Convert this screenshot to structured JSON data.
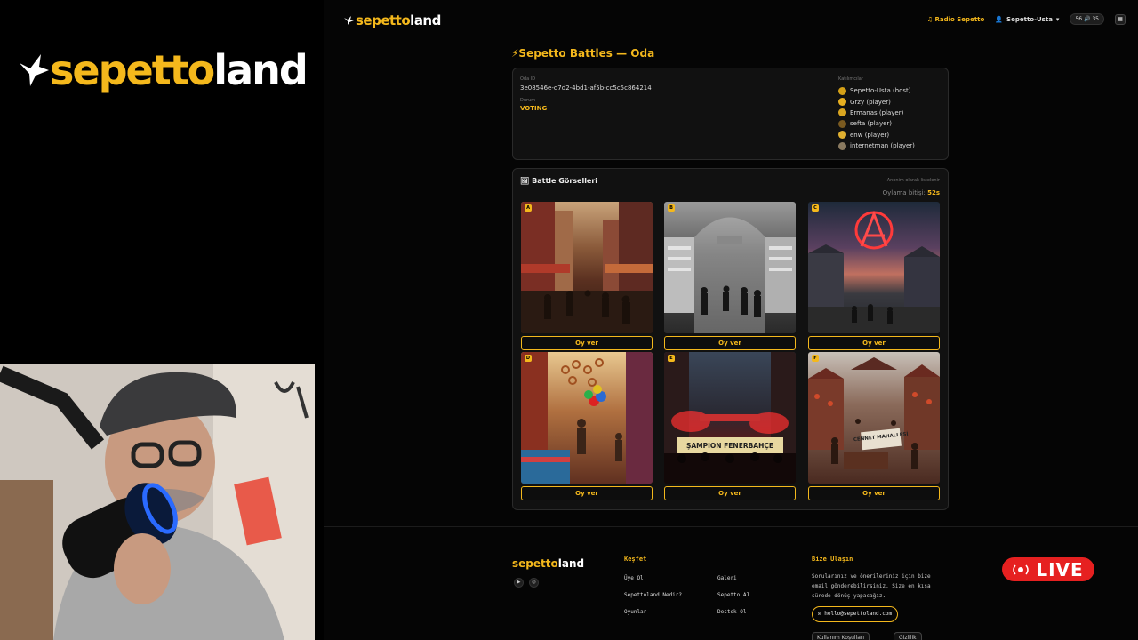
{
  "brand": {
    "part1": "sepetto",
    "part2": "land"
  },
  "nav": {
    "radio": "Radio Sepetto",
    "user": "Sepetto-Usta",
    "counter": "56 🔊 35"
  },
  "page": {
    "heading": "⚡Sepetto Battles — Oda"
  },
  "room": {
    "id_label": "Oda ID",
    "id_value": "3e08546e-d7d2-4bd1-af5b-cc5c5c864214",
    "status_label": "Durum",
    "status_value": "VOTING",
    "participants_label": "Katılımcılar",
    "participants": [
      {
        "name": "Sepetto-Usta (host)",
        "color": "#d4a017"
      },
      {
        "name": "Grzy (player)",
        "color": "#e8b020"
      },
      {
        "name": "Ermanas (player)",
        "color": "#d9a520"
      },
      {
        "name": "sefta (player)",
        "color": "#7a5a20"
      },
      {
        "name": "enw (player)",
        "color": "#e0b030"
      },
      {
        "name": "internetman (player)",
        "color": "#8a7a60"
      }
    ]
  },
  "battle": {
    "title": "Battle Görselleri",
    "anon_note": "Anonim olarak listelenir",
    "timer_label": "Oylama bitişi:",
    "timer_value": "52s",
    "vote_label": "Oy ver",
    "entries": [
      "A",
      "B",
      "C",
      "D",
      "E",
      "F"
    ],
    "banner_e": "ŞAMPİON FENERBAHÇE",
    "banner_f": "CENNET MAHALLESİ"
  },
  "footer": {
    "explore_heading": "Keşfet",
    "links": [
      "Üye Ol",
      "Galeri",
      "Sepettoland Nedir?",
      "Sepetto AI",
      "Oyunlar",
      "Destek Ol"
    ],
    "contact_heading": "Bize Ulaşın",
    "contact_text": "Sorularınız ve önerileriniz için bize email gönderebilirsiniz. Size en kısa sürede dönüş yapacağız.",
    "email": "hello@sepettoland.com",
    "terms": "Kullanım Koşulları",
    "privacy": "Gizlilik",
    "social": [
      "youtube-icon",
      "instagram-icon"
    ]
  },
  "overlay": {
    "live": "LIVE"
  },
  "colors": {
    "accent": "#f4b81c",
    "live": "#e62020",
    "background": "#050505"
  }
}
